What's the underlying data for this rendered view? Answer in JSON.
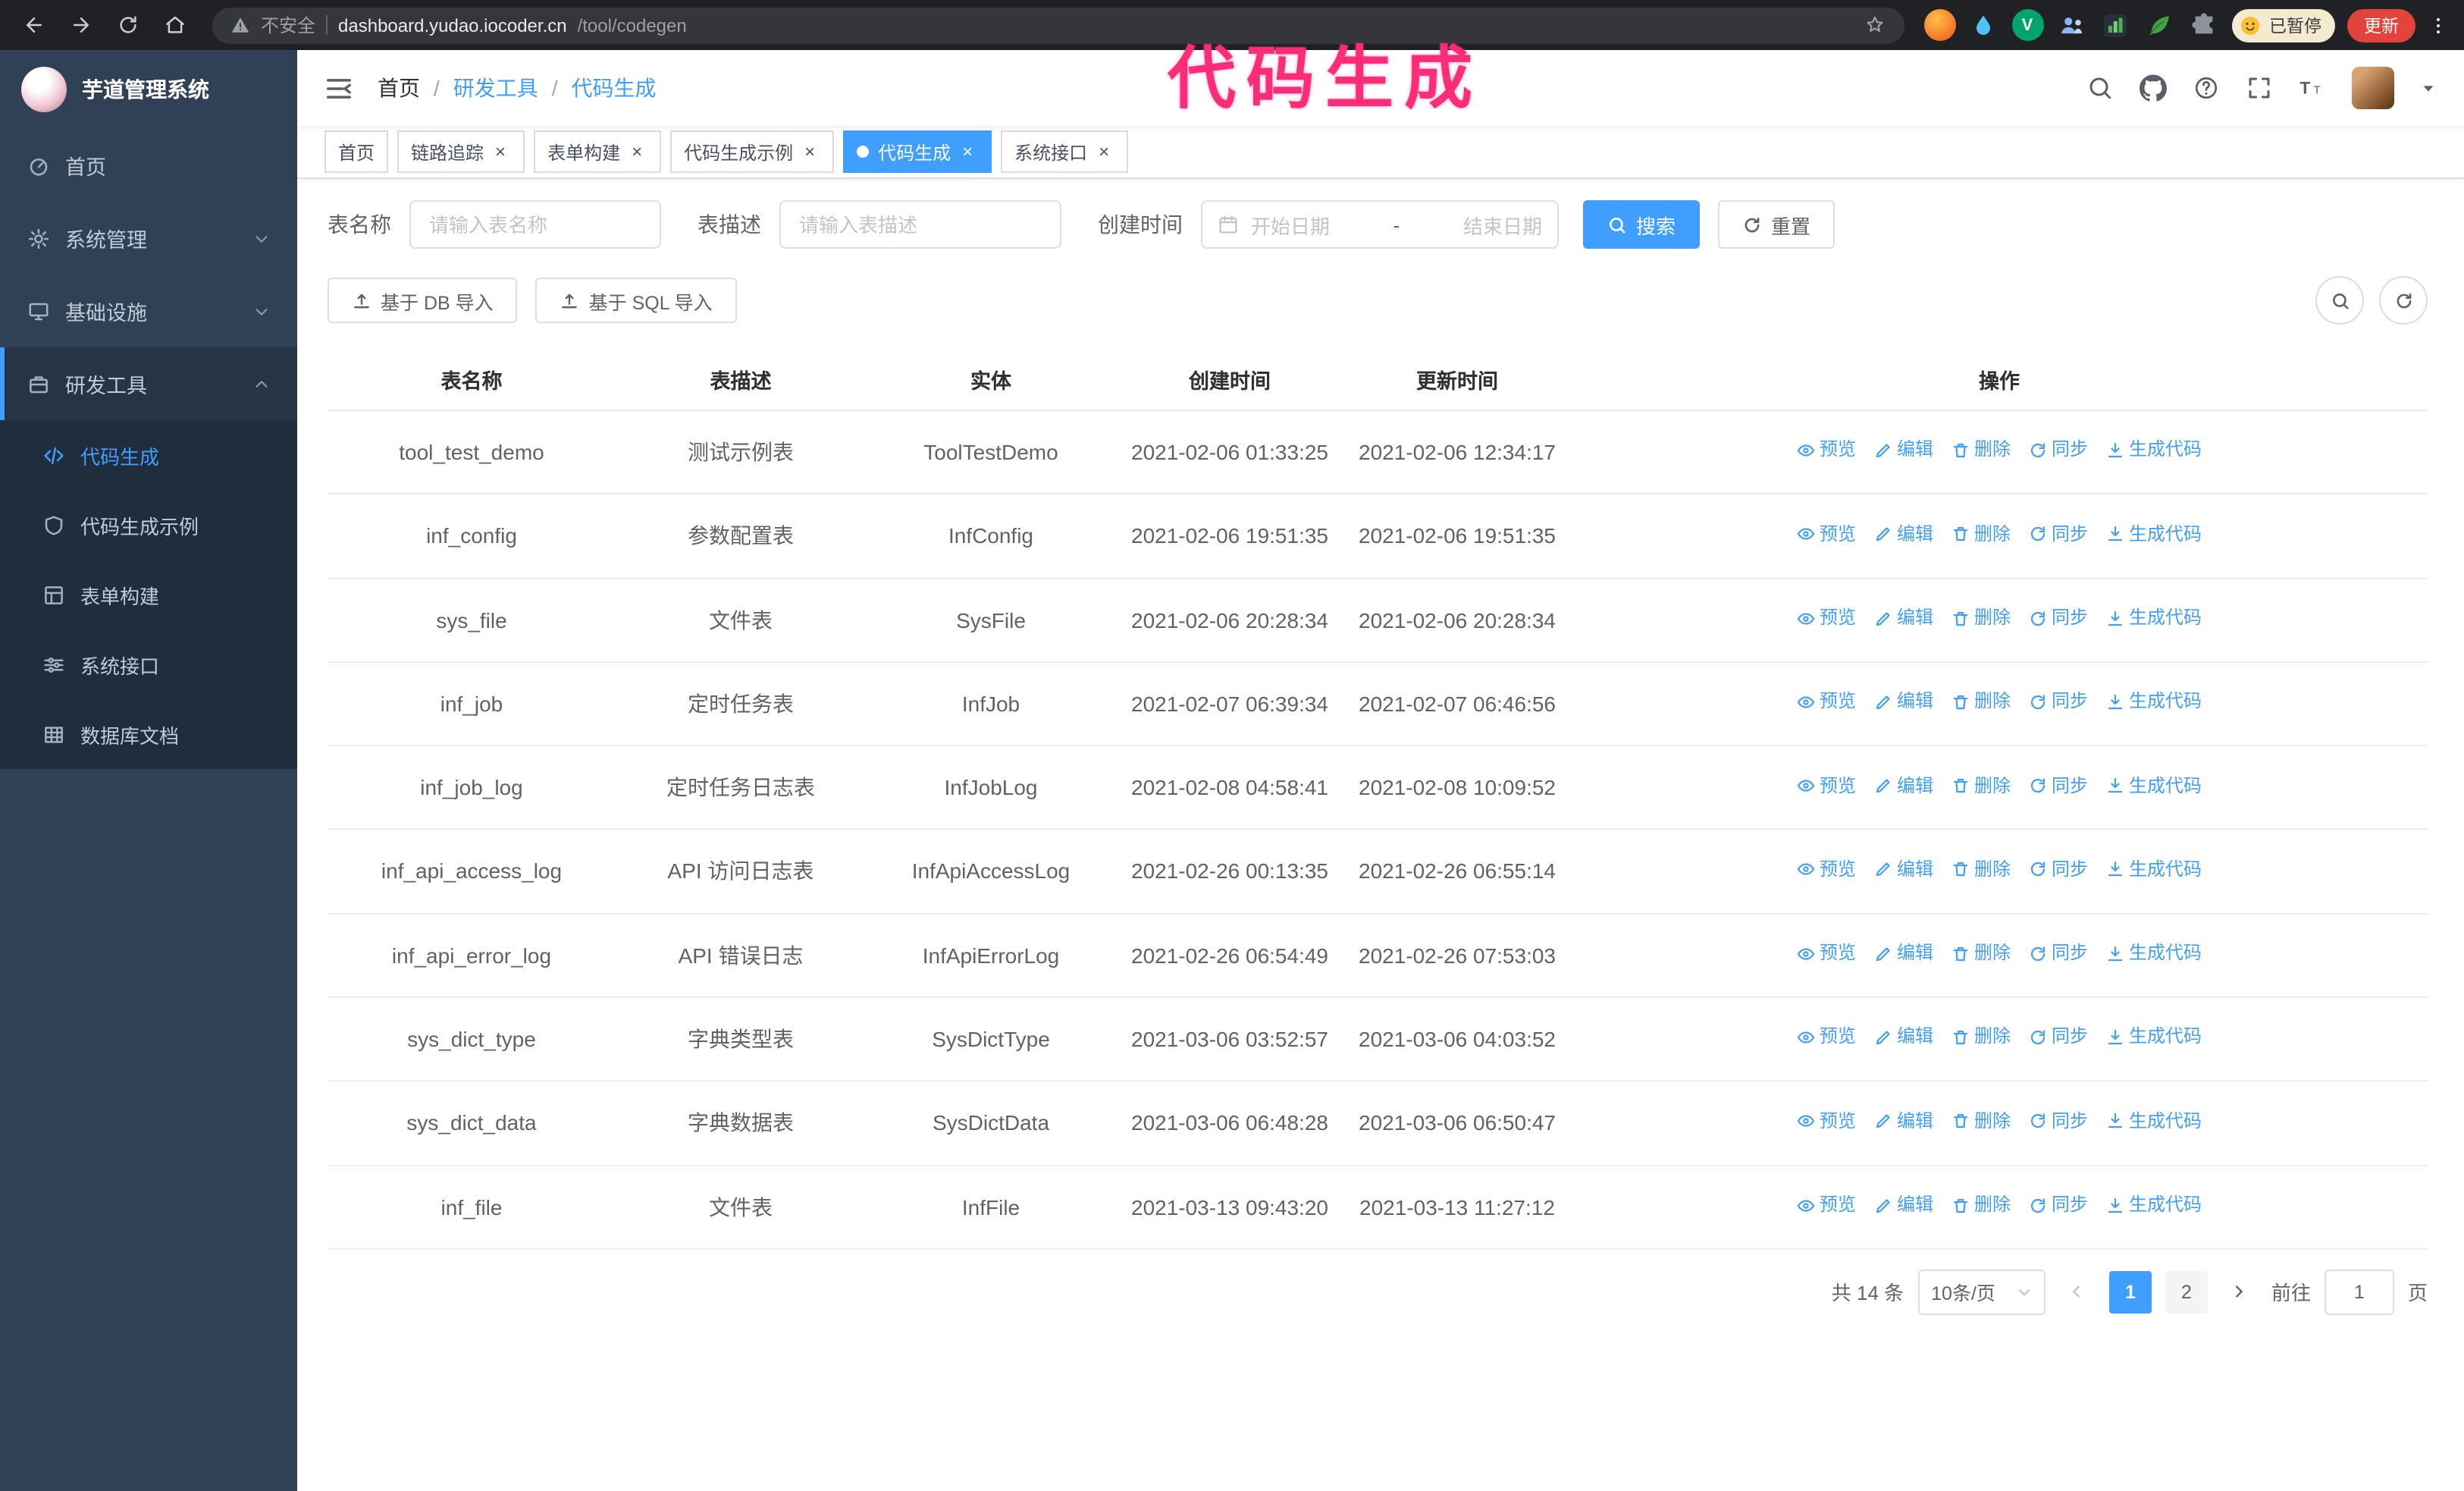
{
  "colors": {
    "primary": "#409eff",
    "sidebar_bg": "#304156",
    "submenu_bg": "#1f2d3d",
    "annotation_pink": "#fb2c7a",
    "update_button_red": "#e2443b",
    "active_tag_blue": "#409eff"
  },
  "browser": {
    "security_label": "不安全",
    "url_host": "dashboard.yudao.iocoder.cn",
    "url_path": "/tool/codegen",
    "paused_badge": "已暂停",
    "update_button": "更新",
    "nav_icons": [
      "back-arrow",
      "forward-arrow",
      "reload",
      "home",
      "warning-triangle",
      "bookmark-star",
      "extension-puzzle",
      "kebab-menu"
    ]
  },
  "annotation": {
    "text": "代码生成"
  },
  "sidebar": {
    "logo_title": "芋道管理系统",
    "items": [
      {
        "label": "首页",
        "icon": "dashboard-icon"
      },
      {
        "label": "系统管理",
        "icon": "gear-icon"
      },
      {
        "label": "基础设施",
        "icon": "monitor-icon"
      },
      {
        "label": "研发工具",
        "icon": "toolbox-icon"
      }
    ],
    "subitems": [
      {
        "label": "代码生成",
        "icon": "code-icon",
        "active": true
      },
      {
        "label": "代码生成示例",
        "icon": "shield-icon",
        "active": false
      },
      {
        "label": "表单构建",
        "icon": "form-grid-icon",
        "active": false
      },
      {
        "label": "系统接口",
        "icon": "sliders-icon",
        "active": false
      },
      {
        "label": "数据库文档",
        "icon": "database-table-icon",
        "active": false
      }
    ]
  },
  "header": {
    "breadcrumb": [
      "首页",
      "研发工具",
      "代码生成"
    ],
    "tool_icons": [
      "search-icon",
      "github-icon",
      "help-icon",
      "fullscreen-icon",
      "font-size-icon",
      "avatar",
      "caret-down-icon"
    ]
  },
  "tabs": [
    {
      "label": "首页",
      "closable": false,
      "active": false
    },
    {
      "label": "链路追踪",
      "closable": true,
      "active": false
    },
    {
      "label": "表单构建",
      "closable": true,
      "active": false
    },
    {
      "label": "代码生成示例",
      "closable": true,
      "active": false
    },
    {
      "label": "代码生成",
      "closable": true,
      "active": true
    },
    {
      "label": "系统接口",
      "closable": true,
      "active": false
    }
  ],
  "filters": {
    "table_name_label": "表名称",
    "table_name_placeholder": "请输入表名称",
    "table_desc_label": "表描述",
    "table_desc_placeholder": "请输入表描述",
    "create_time_label": "创建时间",
    "date_start_placeholder": "开始日期",
    "date_separator": "-",
    "date_end_placeholder": "结束日期",
    "search_button": "搜索",
    "reset_button": "重置"
  },
  "toolbar": {
    "import_db_button": "基于 DB 导入",
    "import_sql_button": "基于 SQL 导入"
  },
  "table": {
    "columns": [
      "表名称",
      "表描述",
      "实体",
      "创建时间",
      "更新时间",
      "操作"
    ],
    "actions": [
      {
        "label": "预览",
        "icon": "eye"
      },
      {
        "label": "编辑",
        "icon": "edit"
      },
      {
        "label": "删除",
        "icon": "trash"
      },
      {
        "label": "同步",
        "icon": "sync"
      },
      {
        "label": "生成代码",
        "icon": "download"
      }
    ],
    "rows": [
      {
        "name": "tool_test_demo",
        "desc": "测试示例表",
        "entity": "ToolTestDemo",
        "created": "2021-02-06 01:33:25",
        "updated": "2021-02-06 12:34:17"
      },
      {
        "name": "inf_config",
        "desc": "参数配置表",
        "entity": "InfConfig",
        "created": "2021-02-06 19:51:35",
        "updated": "2021-02-06 19:51:35"
      },
      {
        "name": "sys_file",
        "desc": "文件表",
        "entity": "SysFile",
        "created": "2021-02-06 20:28:34",
        "updated": "2021-02-06 20:28:34"
      },
      {
        "name": "inf_job",
        "desc": "定时任务表",
        "entity": "InfJob",
        "created": "2021-02-07 06:39:34",
        "updated": "2021-02-07 06:46:56"
      },
      {
        "name": "inf_job_log",
        "desc": "定时任务日志表",
        "entity": "InfJobLog",
        "created": "2021-02-08 04:58:41",
        "updated": "2021-02-08 10:09:52"
      },
      {
        "name": "inf_api_access_log",
        "desc": "API 访问日志表",
        "entity": "InfApiAccessLog",
        "created": "2021-02-26 00:13:35",
        "updated": "2021-02-26 06:55:14"
      },
      {
        "name": "inf_api_error_log",
        "desc": "API 错误日志",
        "entity": "InfApiErrorLog",
        "created": "2021-02-26 06:54:49",
        "updated": "2021-02-26 07:53:03"
      },
      {
        "name": "sys_dict_type",
        "desc": "字典类型表",
        "entity": "SysDictType",
        "created": "2021-03-06 03:52:57",
        "updated": "2021-03-06 04:03:52"
      },
      {
        "name": "sys_dict_data",
        "desc": "字典数据表",
        "entity": "SysDictData",
        "created": "2021-03-06 06:48:28",
        "updated": "2021-03-06 06:50:47"
      },
      {
        "name": "inf_file",
        "desc": "文件表",
        "entity": "InfFile",
        "created": "2021-03-13 09:43:20",
        "updated": "2021-03-13 11:27:12"
      }
    ]
  },
  "pagination": {
    "total_label": "共 14 条",
    "page_size_label": "10条/页",
    "pages": [
      "1",
      "2"
    ],
    "active_page": "1",
    "goto_label": "前往",
    "goto_value": "1",
    "goto_suffix": "页"
  }
}
